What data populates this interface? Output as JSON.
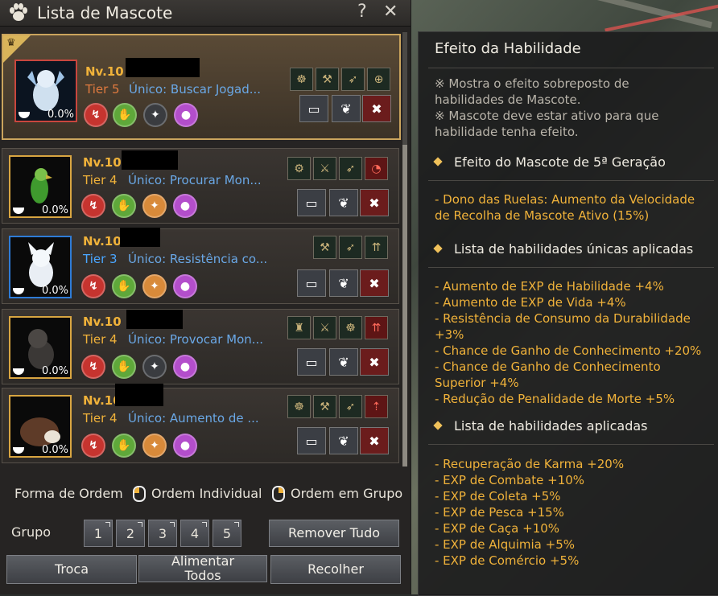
{
  "window": {
    "title": "Lista de Mascote",
    "help_label": "?",
    "close_label": "✕"
  },
  "pets": [
    {
      "level": "Nv.10",
      "tier": "Tier 5",
      "unique": "Único: Buscar Jogad...",
      "hunger": "0.0%"
    },
    {
      "level": "Nv.10",
      "tier": "Tier 4",
      "unique": "Único: Procurar Mon...",
      "hunger": "0.0%"
    },
    {
      "level": "Nv.10",
      "tier": "Tier 3",
      "unique": "Único: Resistência co...",
      "hunger": "0.0%"
    },
    {
      "level": "Nv.10",
      "tier": "Tier 4",
      "unique": "Único: Provocar Mon...",
      "hunger": "0.0%"
    },
    {
      "level": "Nv.10",
      "tier": "Tier 4",
      "unique": "Único: Aumento de ...",
      "hunger": "0.0%"
    }
  ],
  "sort": {
    "label": "Forma de Ordem",
    "individual": "Ordem Individual",
    "group": "Ordem em Grupo"
  },
  "group": {
    "label": "Grupo",
    "buttons": [
      "1",
      "2",
      "3",
      "4",
      "5"
    ],
    "remove_all": "Remover Tudo"
  },
  "actions": {
    "swap": "Troca",
    "feed_all": "Alimentar Todos",
    "collect": "Recolher"
  },
  "effects": {
    "title": "Efeito da Habilidade",
    "note1": "※ Mostra o efeito sobreposto de habilidades de Mascote.",
    "note2": "※ Mascote deve estar ativo para que habilidade tenha efeito.",
    "section1": "Efeito do Mascote de 5ª Geração",
    "gen5_effect": "- Dono das Ruelas: Aumento da Velocidade de Recolha de Mascote Ativo (15%)",
    "section2": "Lista de habilidades únicas aplicadas",
    "unique_skills": [
      "- Aumento de EXP de Habilidade +4%",
      "- Aumento de EXP de Vida +4%",
      "- Resistência de Consumo da Durabilidade +3%",
      "- Chance de Ganho de Conhecimento +20%",
      "- Chance de Ganho de Conhecimento Superior +4%",
      "- Redução de Penalidade de Morte +5%"
    ],
    "section3": "Lista de habilidades aplicadas",
    "skills": [
      "- Recuperação de Karma +20%",
      "- EXP de Combate +10%",
      "- EXP de Coleta +5%",
      "- EXP de Pesca +15%",
      "- EXP de Caça +10%",
      "- EXP de Alquimia +5%",
      "- EXP de Comércio +5%"
    ]
  },
  "colors": {
    "accent_gold": "#f0b23a",
    "tier_blue": "#4aa6ff",
    "unique_blue": "#6aa8e6"
  }
}
